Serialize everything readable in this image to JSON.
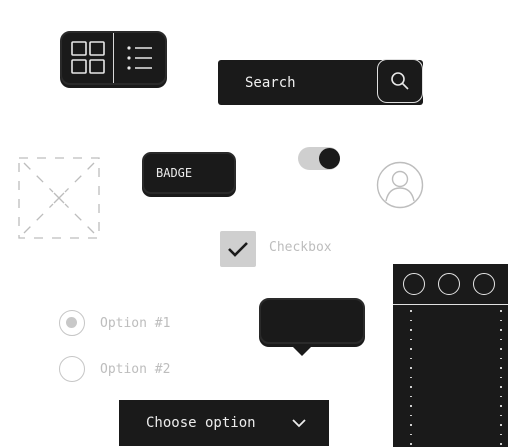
{
  "view_toggle": {
    "grid_icon": "grid-icon",
    "list_icon": "list-icon"
  },
  "search": {
    "placeholder": "Search",
    "button_icon": "search-icon"
  },
  "image_placeholder": {
    "icon": "image-placeholder-icon"
  },
  "badge": {
    "label": "BADGE"
  },
  "toggle_switch": {
    "state": "on"
  },
  "avatar": {
    "icon": "user-icon"
  },
  "checkbox": {
    "label": "Checkbox",
    "checked": true
  },
  "radios": [
    {
      "label": "Option #1",
      "selected": true
    },
    {
      "label": "Option #2",
      "selected": false
    }
  ],
  "tooltip": {
    "text": ""
  },
  "dropdown": {
    "selected": "Choose option",
    "icon": "chevron-down-icon"
  },
  "browser_window": {
    "buttons": [
      "window-button",
      "window-button",
      "window-button"
    ]
  },
  "colors": {
    "dark": "#1a1a1a",
    "light_gray": "#cfcfcf",
    "muted_text": "#bdbdbd",
    "background": "#ffffff"
  }
}
